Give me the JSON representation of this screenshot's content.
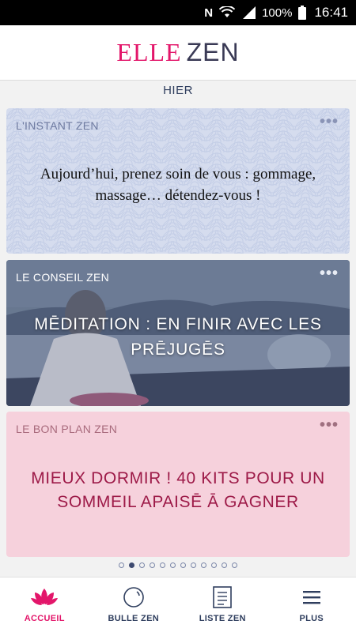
{
  "status_bar": {
    "n_label": "N",
    "battery": "100%",
    "time": "16:41"
  },
  "header": {
    "logo_elle": "ELLE",
    "logo_zen": "ZEN"
  },
  "day_label": "HIER",
  "cards": [
    {
      "kicker": "L'INSTANT ZEN",
      "more": "•••",
      "text": "Aujourd’hui, prenez soin de vous : gommage, massage… détendez-vous !"
    },
    {
      "kicker": "LE CONSEIL ZEN",
      "more": "•••",
      "text": "MĒDITATION : EN FINIR AVEC LES PRĒJUGĒS"
    },
    {
      "kicker": "LE BON PLAN ZEN",
      "more": "•••",
      "text": "MIEUX DORMIR !  40 KITS  POUR UN SOMMEIL APAISĒ Ā GAGNER"
    }
  ],
  "pager": {
    "count": 12,
    "active_index": 1
  },
  "bottom_nav": [
    {
      "label": "ACCUEIL",
      "icon": "lotus-icon",
      "active": true
    },
    {
      "label": "BULLE ZEN",
      "icon": "bubble-icon",
      "active": false
    },
    {
      "label": "LISTE ZEN",
      "icon": "list-icon",
      "active": false
    },
    {
      "label": "PLUS",
      "icon": "menu-icon",
      "active": false
    }
  ],
  "colors": {
    "accent": "#e3166a",
    "navy": "#2f3e5e",
    "card1_bg": "#d5dcee",
    "card3_bg": "#f6d1dc",
    "card3_text": "#9d1a48"
  }
}
